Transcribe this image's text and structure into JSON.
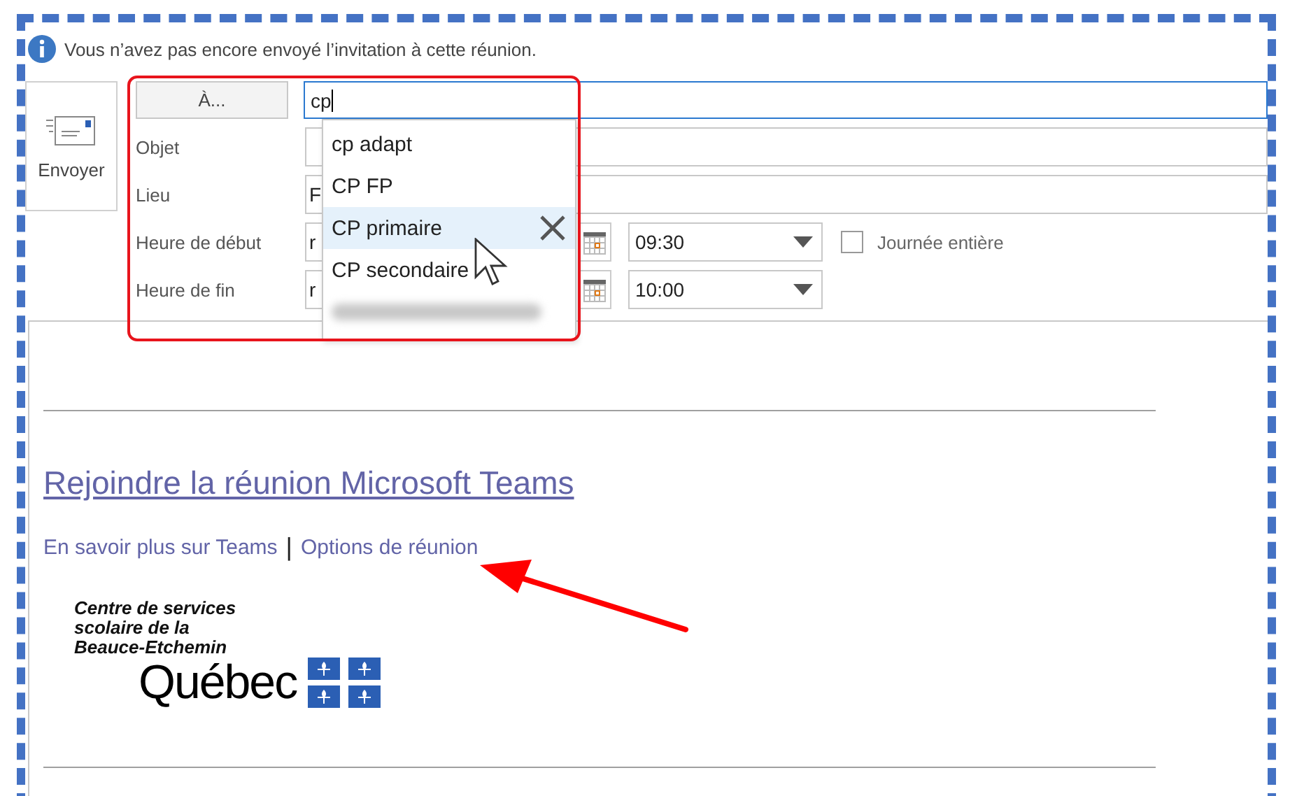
{
  "info_bar": {
    "message": "Vous n’avez pas encore envoyé l’invitation à cette réunion."
  },
  "send_button": {
    "label": "Envoyer"
  },
  "to_button": {
    "label": "À..."
  },
  "to_field": {
    "value": "cp"
  },
  "fields": [
    {
      "kind": "text",
      "label": "Objet"
    },
    {
      "kind": "text",
      "label": "Lieu",
      "value": "F"
    },
    {
      "kind": "datetime",
      "label": "Heure de début",
      "date": "r",
      "time": "09:30",
      "all_day": {
        "label": "Journée entière",
        "checked": false
      }
    },
    {
      "kind": "datetime",
      "label": "Heure de fin",
      "date": "r",
      "time": "10:00"
    }
  ],
  "autocomplete": [
    {
      "kind": "contact",
      "label": "cp adapt",
      "selected": false
    },
    {
      "kind": "contact",
      "label": "CP FP",
      "selected": false
    },
    {
      "kind": "contact",
      "label": "CP primaire",
      "selected": true
    },
    {
      "kind": "contact",
      "label": "CP secondaire",
      "selected": false
    },
    {
      "kind": "redacted",
      "selected": false
    }
  ],
  "body": {
    "join_link": "Rejoindre la réunion Microsoft Teams",
    "links": [
      "En savoir plus sur Teams",
      "Options de réunion"
    ],
    "separator": "|",
    "logo": {
      "org_lines": [
        "Centre de services",
        "scolaire de la",
        "Beauce-Etchemin"
      ],
      "wordmark": "Québec"
    }
  }
}
